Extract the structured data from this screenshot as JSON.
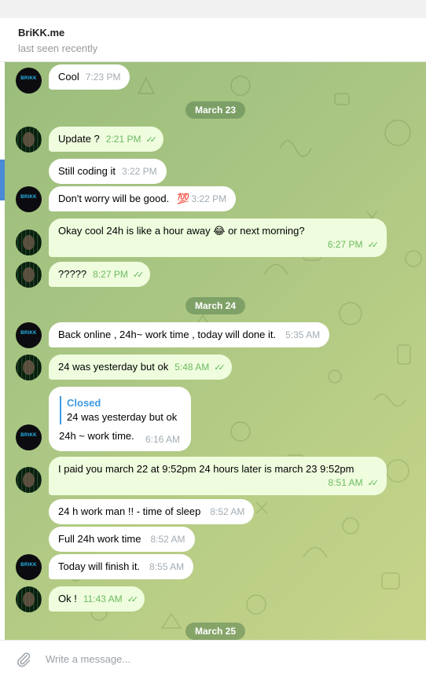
{
  "header": {
    "name": "BriKK.me",
    "status": "last seen recently"
  },
  "avatars": {
    "brikk_text": "BRIKK"
  },
  "dates": [
    "March 23",
    "March 24",
    "March 25"
  ],
  "messages": [
    {
      "text": "Cool",
      "time": "7:23 PM",
      "dir": "in"
    },
    {
      "text": "Update ?",
      "time": "2:21 PM",
      "dir": "out"
    },
    {
      "text": "Still coding it",
      "time": "3:22 PM",
      "dir": "in"
    },
    {
      "text": "Don't worry will be good.",
      "emoji": "💯",
      "time": "3:22 PM",
      "dir": "in"
    },
    {
      "text": "Okay cool 24h is like a hour away 😂 or next morning?",
      "time": "6:27 PM",
      "dir": "out"
    },
    {
      "text": "?????",
      "time": "8:27 PM",
      "dir": "out"
    },
    {
      "text": "Back online , 24h~ work time , today will done it.",
      "time": "5:35 AM",
      "dir": "in"
    },
    {
      "text": "24 was yesterday but ok",
      "time": "5:48 AM",
      "dir": "out"
    },
    {
      "reply_name": "Closed",
      "reply_text": "24 was yesterday but ok",
      "text": "24h ~ work time.",
      "time": "6:16 AM",
      "dir": "in"
    },
    {
      "text": "I paid you march 22 at 9:52pm 24 hours later is march 23 9:52pm",
      "time": "8:51 AM",
      "dir": "out"
    },
    {
      "text": "24 h work man !! - time of sleep",
      "time": "8:52 AM",
      "dir": "in"
    },
    {
      "text": "Full 24h work time",
      "time": "8:52 AM",
      "dir": "in"
    },
    {
      "text": "Today will finish it.",
      "time": "8:55 AM",
      "dir": "in"
    },
    {
      "text": "Ok !",
      "time": "11:43 AM",
      "dir": "out"
    }
  ],
  "composer": {
    "placeholder": "Write a message...",
    "attach_icon": "paperclip-icon"
  },
  "colors": {
    "outgoing_bubble": "#effdde",
    "incoming_bubble": "#ffffff",
    "read_check": "#5fb65a",
    "reply_accent": "#3e9ae3"
  }
}
